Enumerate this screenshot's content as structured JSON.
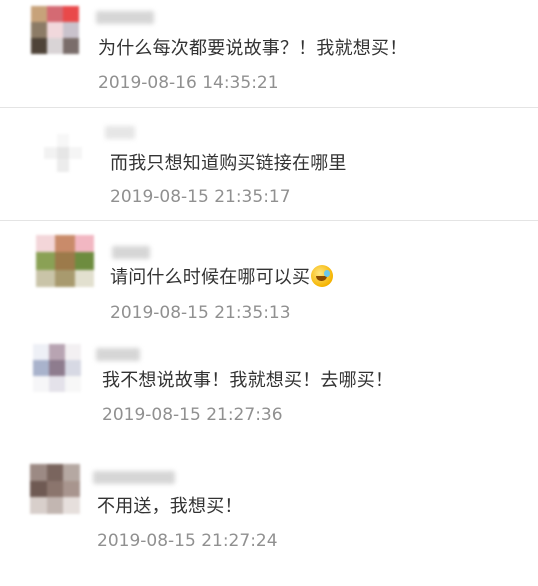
{
  "comments": [
    {
      "text": "为什么每次都要说故事？！我就想买！",
      "time": "2019-08-16 14:35:21",
      "avatar_colors": [
        "#c7a27a",
        "#d46a73",
        "#e9494a",
        "#8c7b66",
        "#f1d8dc",
        "#c9c2cc",
        "#4e4338",
        "#d9d4d6",
        "#7a6d6a"
      ]
    },
    {
      "text": "而我只想知道购买链接在哪里",
      "time": "2019-08-15 21:35:17",
      "avatar_colors": [
        "#ffffff",
        "#f7f7f7",
        "#ffffff",
        "#f2f2f2",
        "#e6e6e6",
        "#f5f5f5",
        "#ffffff",
        "#ececec",
        "#ffffff"
      ]
    },
    {
      "text": "请问什么时候在哪可以买",
      "emoji": "crying-laughing-face",
      "time": "2019-08-15 21:35:13",
      "avatar_colors": [
        "#f3d6d9",
        "#c98b6a",
        "#f2b7c2",
        "#8aa155",
        "#9c7a4a",
        "#6d8c3f",
        "#c9c4a8",
        "#a89a6e",
        "#e2e0cf"
      ]
    },
    {
      "text": "我不想说故事！我就想买！去哪买！",
      "time": "2019-08-15 21:27:36",
      "avatar_colors": [
        "#eef0f6",
        "#b8a4b2",
        "#f3f0f2",
        "#a9b3cc",
        "#8e7c8e",
        "#d7d9e4",
        "#f6f6f8",
        "#e4e2ea",
        "#f7f7f7"
      ]
    },
    {
      "text": "不用送，我想买！",
      "time": "2019-08-15 21:27:24",
      "avatar_colors": [
        "#9c8a84",
        "#7a655e",
        "#b5a8a2",
        "#6f5a53",
        "#8b756d",
        "#a8958e",
        "#d8cfcb",
        "#c2b6b1",
        "#e6dfdc"
      ]
    }
  ]
}
